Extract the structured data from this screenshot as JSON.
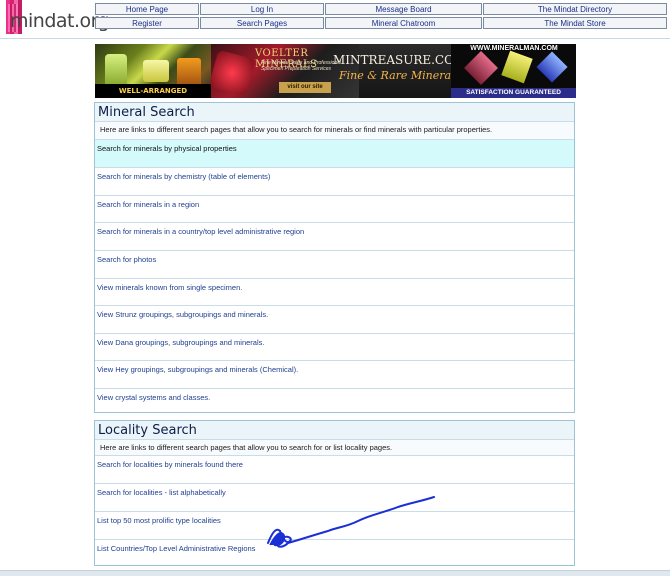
{
  "logo": {
    "text": "mindat.org"
  },
  "nav": [
    "Home Page",
    "Log In",
    "Message Board",
    "The Mindat Directory",
    "Register",
    "Search Pages",
    "Mineral Chatroom",
    "The Mindat Store"
  ],
  "banner": {
    "well_arranged": "WELL-ARRANGED MOLECULES",
    "voelter": "VOELTER MINERALS",
    "voelter_sub": "Fine Mineral Sales and Professional Specimen Preparation Services",
    "visit": "visit our site",
    "mintreasure": "MINTREASURE.COM",
    "fine_rare": "Fine & Rare Minerals",
    "mineralman": "WWW.MINERALMAN.COM",
    "satisfaction": "SATISFACTION GUARANTEED"
  },
  "mineral_search": {
    "title": "Mineral Search",
    "description": "Here are links to different search pages that allow you to search for minerals or find minerals with particular properties.",
    "links": [
      "Search for minerals by physical properties",
      "Search for minerals by chemistry (table of elements)",
      "Search for minerals in a region",
      "Search for minerals in a country/top level administrative region",
      "Search for photos",
      "View minerals known from single specimen.",
      "View Strunz groupings, subgroupings and minerals.",
      "View Dana groupings, subgroupings and minerals.",
      "View Hey groupings, subgroupings and minerals (Chemical).",
      "View crystal systems and classes."
    ]
  },
  "locality_search": {
    "title": "Locality Search",
    "description": "Here are links to different search pages that allow you to search for or list locality pages.",
    "links": [
      "Search for localities by minerals found there",
      "Search for localities - list alphabetically",
      "List top 50 most prolific type localities",
      "List Countries/Top Level Administrative Regions"
    ]
  },
  "colors": {
    "link": "#1e3f8f",
    "highlight_row": "#d4fafc",
    "panel_border": "#9ec3d6",
    "scribble": "#1a2fd6"
  }
}
